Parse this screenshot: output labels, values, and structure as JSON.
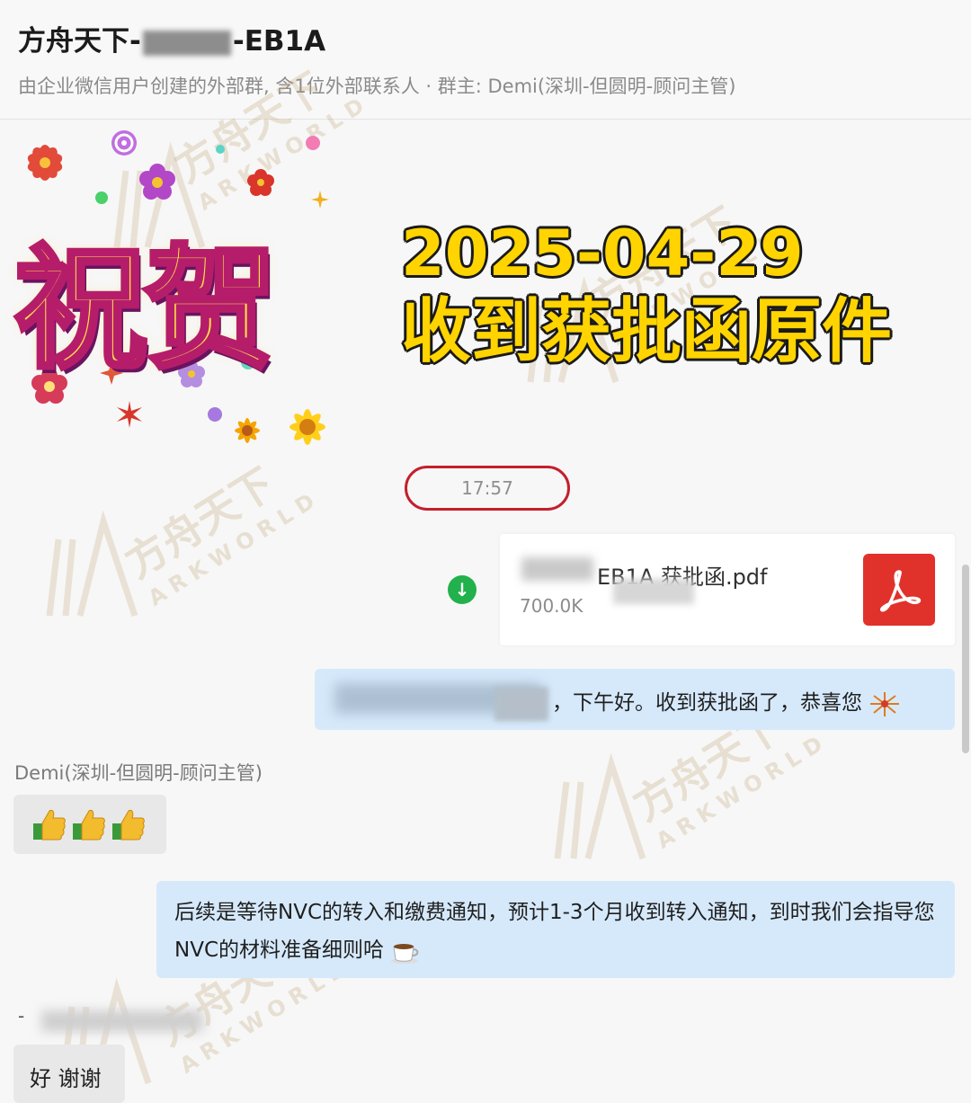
{
  "header": {
    "title_prefix": "方舟天下-",
    "title_suffix": "-EB1A",
    "subtitle": "由企业微信用户创建的外部群, 含1位外部联系人 · 群主: Demi(深圳-但圆明-顾问主管)"
  },
  "banner": {
    "congrats": "祝贺",
    "date": "2025-04-29",
    "headline": "收到获批函原件"
  },
  "watermark": {
    "cn": "方舟天下",
    "en": "ARKWORLD"
  },
  "chat": {
    "timestamp": "17:57",
    "file": {
      "name": "EB1A 获批函.pdf",
      "size": "700.0K",
      "icon": "pdf-icon"
    },
    "message1": "，下午好。收到获批函了，恭喜您",
    "sender_demi": "Demi(深圳-但圆明-顾问主管)",
    "message3": "后续是等待NVC的转入和缴费通知，预计1-3个月收到转入通知，到时我们会指导您NVC的材料准备细则哈",
    "sender2_dash": "-",
    "message4": "好 谢谢"
  }
}
